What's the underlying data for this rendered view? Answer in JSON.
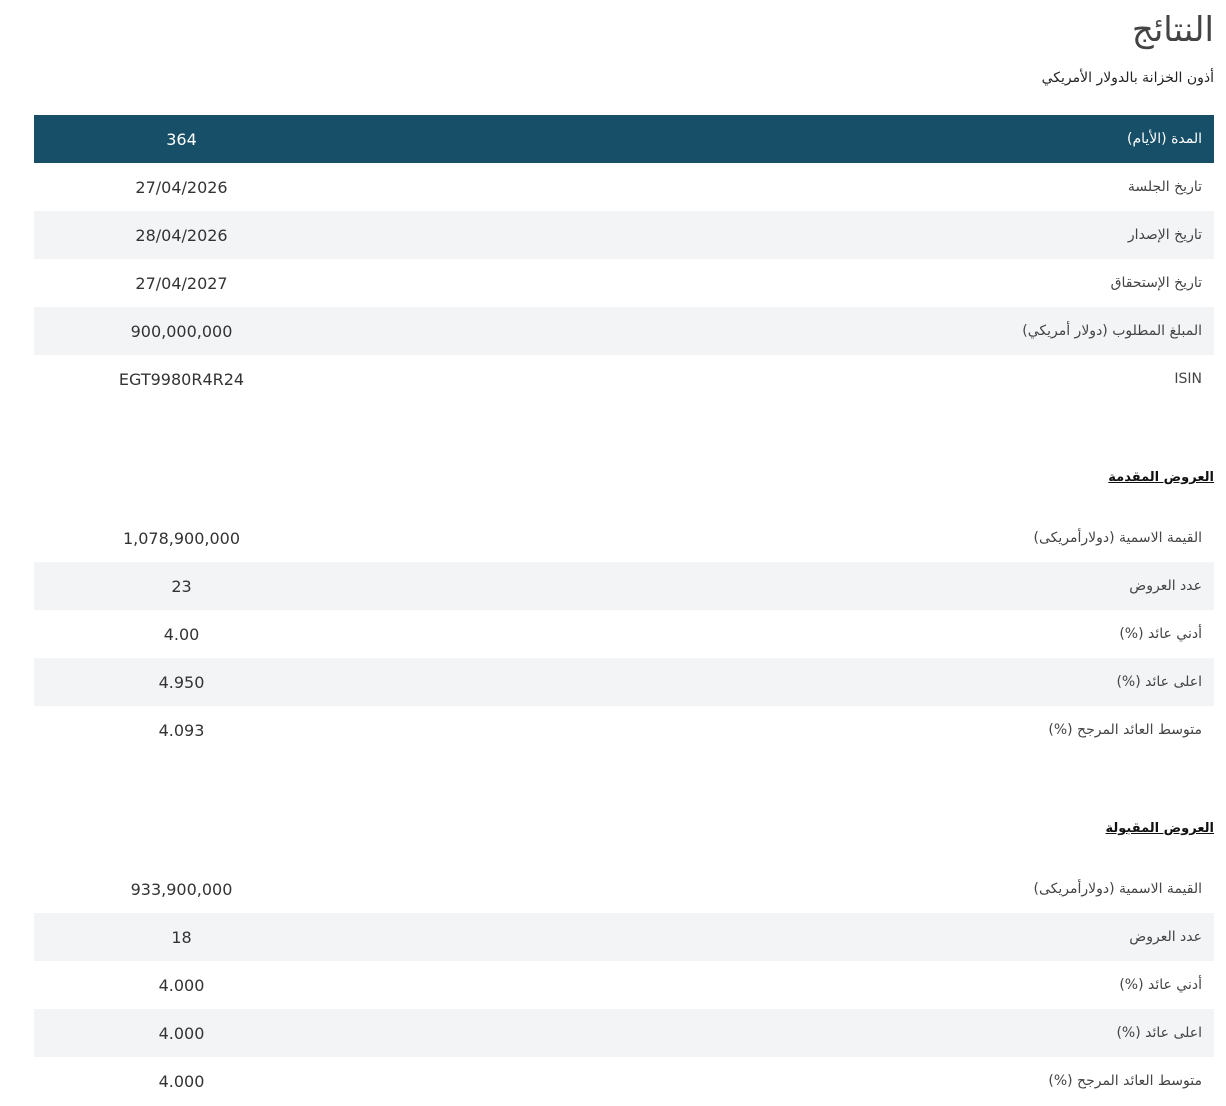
{
  "header": {
    "title": "النتائج",
    "subtitle": "أذون الخزانة بالدولار الأمريكي"
  },
  "main_table": {
    "rows": [
      {
        "label": "المدة (الأيام)",
        "value": "364"
      },
      {
        "label": "تاريخ الجلسة",
        "value": "27/04/2026"
      },
      {
        "label": "تاريخ الإصدار",
        "value": "28/04/2026"
      },
      {
        "label": "تاريخ الإستحقاق",
        "value": "27/04/2027"
      },
      {
        "label": "المبلغ المطلوب (دولار أمريكي)",
        "value": "900,000,000"
      },
      {
        "label": "ISIN",
        "value": "EGT9980R4R24"
      }
    ]
  },
  "submitted_bids": {
    "title": "العروض المقدمة",
    "rows": [
      {
        "label": "القيمة الاسمية (دولارأمريكى)",
        "value": "1,078,900,000"
      },
      {
        "label": "عدد العروض",
        "value": "23"
      },
      {
        "label": "أدني عائد (%)",
        "value": "4.00"
      },
      {
        "label": "اعلى عائد (%)",
        "value": "4.950"
      },
      {
        "label": "متوسط العائد المرجح (%)",
        "value": "4.093"
      }
    ]
  },
  "accepted_bids": {
    "title": "العروض المقبولة",
    "rows": [
      {
        "label": "القيمة الاسمية (دولارأمريكى)",
        "value": "933,900,000"
      },
      {
        "label": "عدد العروض",
        "value": "18"
      },
      {
        "label": "أدني عائد (%)",
        "value": "4.000"
      },
      {
        "label": "اعلى عائد (%)",
        "value": "4.000"
      },
      {
        "label": "متوسط العائد المرجح (%)",
        "value": "4.000"
      }
    ]
  },
  "colors": {
    "header_row_bg": "#174f68",
    "alt_row_bg": "#f3f4f6"
  }
}
